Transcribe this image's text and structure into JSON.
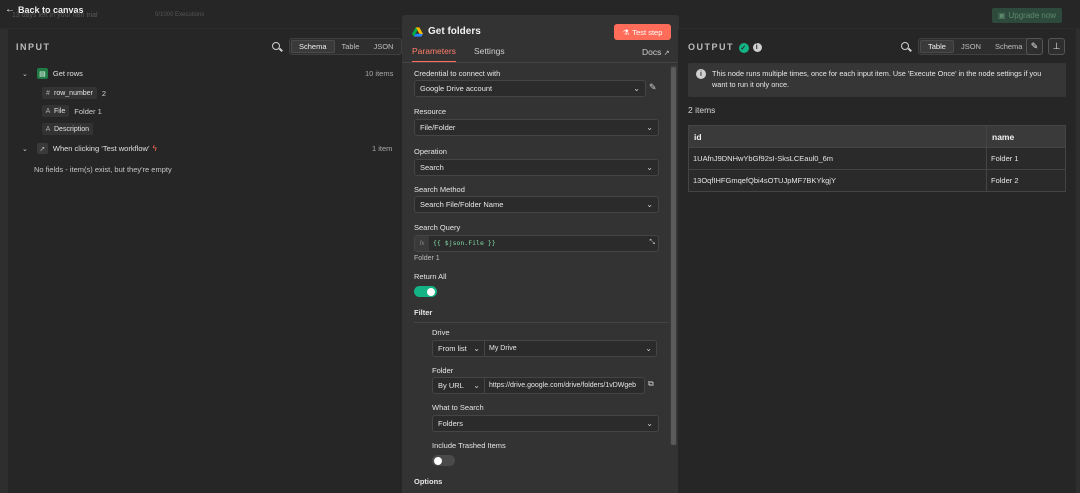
{
  "topbar": {
    "back_label": "Back to canvas",
    "trial_text": "13 days left in your n8n trial",
    "executions_text": "0/1000 Executions",
    "upgrade_label": "Upgrade now"
  },
  "input": {
    "title": "INPUT",
    "view_tabs": [
      "Schema",
      "Table",
      "JSON"
    ],
    "active_tab": "Schema",
    "nodes": [
      {
        "name": "Get rows",
        "count": "10 items",
        "fields": [
          {
            "type_glyph": "#",
            "name": "row_number",
            "value": "2"
          },
          {
            "type_glyph": "A",
            "name": "File",
            "value": "Folder 1"
          },
          {
            "type_glyph": "A",
            "name": "Description",
            "value": ""
          }
        ]
      },
      {
        "name": "When clicking ‘Test workflow’",
        "count": "1 item",
        "empty_message": "No fields - item(s) exist, but they're empty"
      }
    ]
  },
  "node": {
    "title": "Get folders",
    "test_label": "Test step",
    "tabs": [
      "Parameters",
      "Settings"
    ],
    "active_tab": "Parameters",
    "docs_label": "Docs",
    "params": {
      "credential_label": "Credential to connect with",
      "credential_value": "Google Drive account",
      "resource_label": "Resource",
      "resource_value": "File/Folder",
      "operation_label": "Operation",
      "operation_value": "Search",
      "search_method_label": "Search Method",
      "search_method_value": "Search File/Folder Name",
      "search_query_label": "Search Query",
      "search_query_expr": "{{ $json.File }}",
      "search_query_preview": "Folder 1",
      "return_all_label": "Return All",
      "return_all_on": true,
      "filter_label": "Filter",
      "drive_label": "Drive",
      "drive_mode": "From list",
      "drive_value": "My Drive",
      "folder_label": "Folder",
      "folder_mode": "By URL",
      "folder_value": "https://drive.google.com/drive/folders/1vDWgeb",
      "what_to_search_label": "What to Search",
      "what_to_search_value": "Folders",
      "include_trashed_label": "Include Trashed Items",
      "include_trashed_on": false,
      "options_label": "Options"
    }
  },
  "output": {
    "title": "OUTPUT",
    "view_tabs": [
      "Table",
      "JSON",
      "Schema"
    ],
    "active_tab": "Table",
    "notice": "This node runs multiple times, once for each input item. Use 'Execute Once' in the node settings if you want to run it only once.",
    "items_count": "2 items",
    "columns": [
      "id",
      "name"
    ],
    "rows": [
      [
        "1UAfnJ9DNHwYbGf92sI-SksLCEaul0_6m",
        "Folder 1"
      ],
      [
        "13OqfIHFGmqefQbi4sOTUJpMF7BKYkgjY",
        "Folder 2"
      ]
    ]
  },
  "colors": {
    "accent": "#ff6d5a",
    "success": "#13b385",
    "panel": "#262626",
    "node_bg": "#333333"
  }
}
